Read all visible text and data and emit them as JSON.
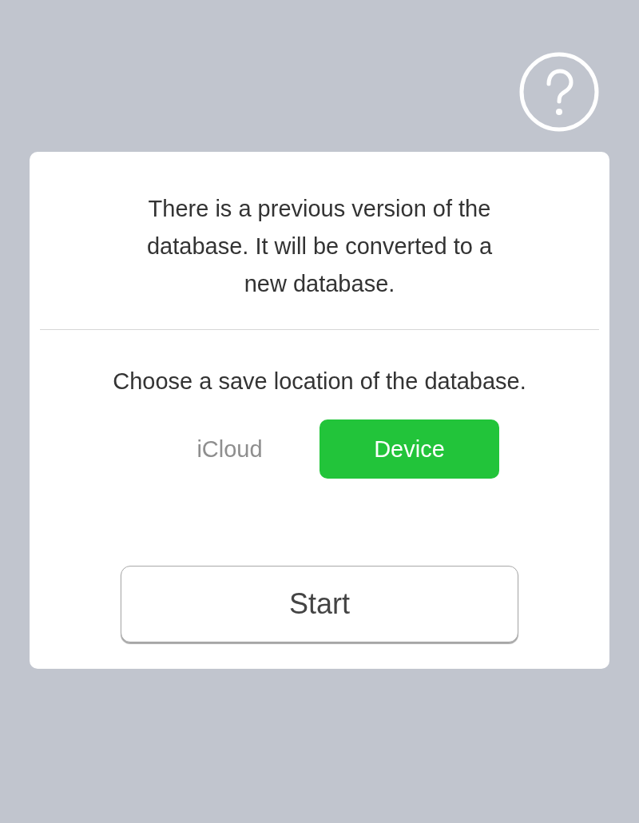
{
  "message": "There is a previous version of the database. It will be converted to a new database.",
  "prompt": "Choose a save location of the database.",
  "locations": [
    {
      "label": "iCloud",
      "selected": false
    },
    {
      "label": "Device",
      "selected": true
    }
  ],
  "start_button": {
    "label": "Start"
  }
}
